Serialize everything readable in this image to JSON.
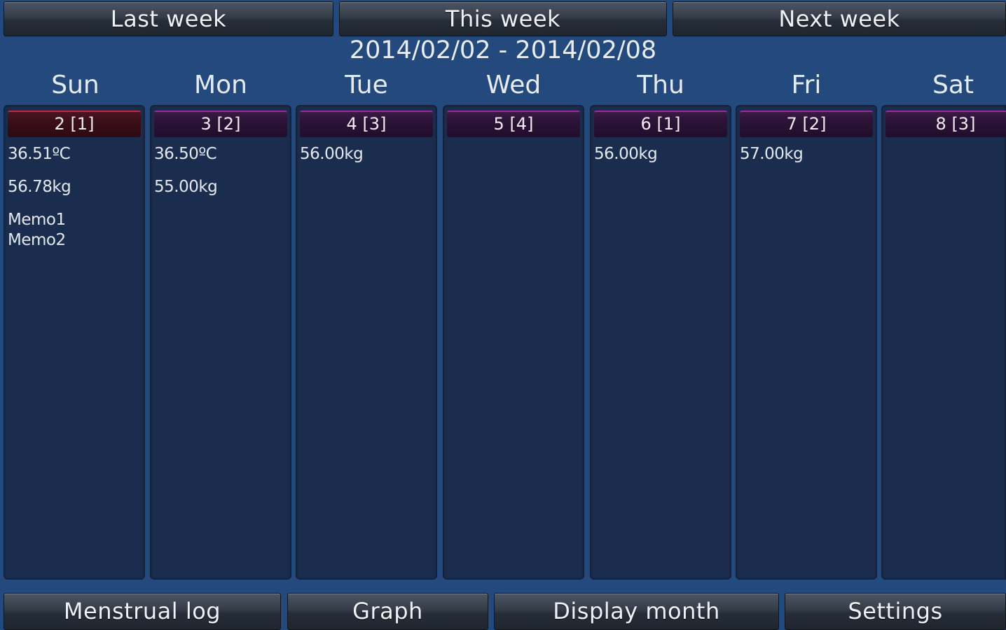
{
  "nav": {
    "last_week": "Last week",
    "this_week": "This week",
    "next_week": "Next week"
  },
  "date_range": "2014/02/02 - 2014/02/08",
  "days": [
    {
      "name": "Sun",
      "badge": "2 [1]",
      "entries": [
        "36.51ºC",
        "56.78kg"
      ],
      "memos": [
        "Memo1",
        "Memo2"
      ]
    },
    {
      "name": "Mon",
      "badge": "3 [2]",
      "entries": [
        "36.50ºC",
        "55.00kg"
      ],
      "memos": []
    },
    {
      "name": "Tue",
      "badge": "4 [3]",
      "entries": [
        "56.00kg"
      ],
      "memos": []
    },
    {
      "name": "Wed",
      "badge": "5 [4]",
      "entries": [],
      "memos": []
    },
    {
      "name": "Thu",
      "badge": "6 [1]",
      "entries": [
        "56.00kg"
      ],
      "memos": []
    },
    {
      "name": "Fri",
      "badge": "7 [2]",
      "entries": [
        "57.00kg"
      ],
      "memos": []
    },
    {
      "name": "Sat",
      "badge": "8 [3]",
      "entries": [],
      "memos": []
    }
  ],
  "bottom": {
    "menstrual_log": "Menstrual log",
    "graph": "Graph",
    "display_month": "Display month",
    "settings": "Settings"
  },
  "colors": {
    "background": "#244a7d",
    "column": "#1b2d4e",
    "badge_sunday_accent": "#c02a3a",
    "badge_accent": "#9b2a9f"
  }
}
